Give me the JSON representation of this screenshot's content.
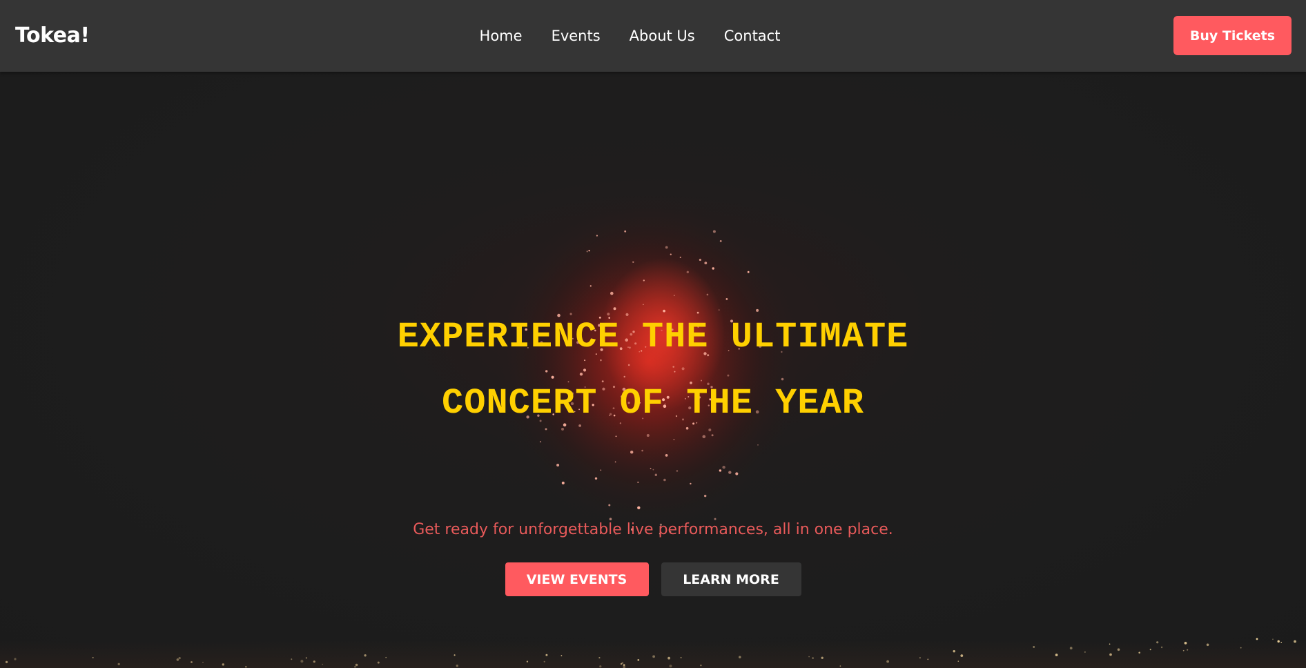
{
  "navbar": {
    "brand": "Tokea!",
    "links": [
      "Home",
      "Events",
      "About Us",
      "Contact"
    ],
    "cta_label": "Buy Tickets"
  },
  "hero": {
    "title_line1": "EXPERIENCE THE ULTIMATE",
    "title_line2": "CONCERT OF THE YEAR",
    "subtitle": "Get ready for unforgettable live performances, all in one place.",
    "primary_button": "VIEW EVENTS",
    "secondary_button": "LEARN MORE",
    "background_image": "fireworks-night-image"
  },
  "colors": {
    "accent": "#ff5a5f",
    "title": "#ffd000",
    "subtitle": "#e85a5a",
    "navbar": "#353535",
    "background": "#1e1e1e"
  }
}
